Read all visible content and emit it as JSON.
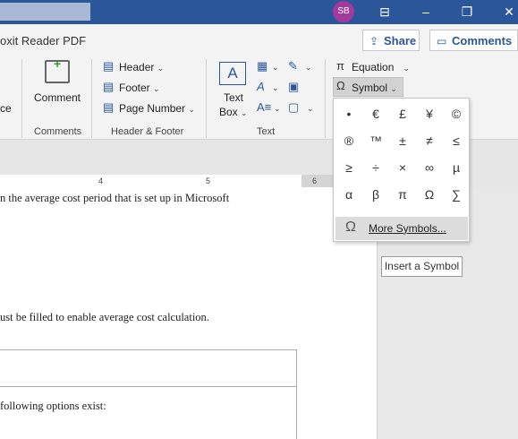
{
  "titlebar": {
    "avatar_initials": "SB",
    "icons": [
      "ribbon-display-icon",
      "minimize-icon",
      "restore-icon",
      "close-icon"
    ]
  },
  "tabs": {
    "partial_tab": "oxit Reader PDF",
    "share_label": "Share",
    "comments_label": "Comments"
  },
  "ribbon": {
    "partial_label": "ce",
    "comment_label": "Comment",
    "comments_group": "Comments",
    "header_label": "Header",
    "footer_label": "Footer",
    "page_number_label": "Page Number",
    "header_footer_group": "Header & Footer",
    "text_box_label_1": "Text",
    "text_box_label_2": "Box",
    "text_group": "Text",
    "equation_label": "Equation",
    "symbol_label": "Symbol"
  },
  "ruler": {
    "numbers": [
      "4",
      "5",
      "6"
    ]
  },
  "document": {
    "line1": "n the average cost period that is set up in Microsoft",
    "line2": "ust be filled to enable average cost calculation.",
    "line3": "following options exist:"
  },
  "symbol_menu": {
    "symbols": [
      "•",
      "€",
      "£",
      "¥",
      "©",
      "®",
      "™",
      "±",
      "≠",
      "≤",
      "≥",
      "÷",
      "×",
      "∞",
      "µ",
      "α",
      "β",
      "π",
      "Ω",
      "∑"
    ],
    "more_symbols_label": "More Symbols...",
    "more_symbols_icon": "omega-icon"
  },
  "tooltip": {
    "text": "Insert a Symbol"
  },
  "colors": {
    "titlebar": "#2b579a",
    "accent": "#2b579a",
    "avatar": "#a23a9e"
  }
}
